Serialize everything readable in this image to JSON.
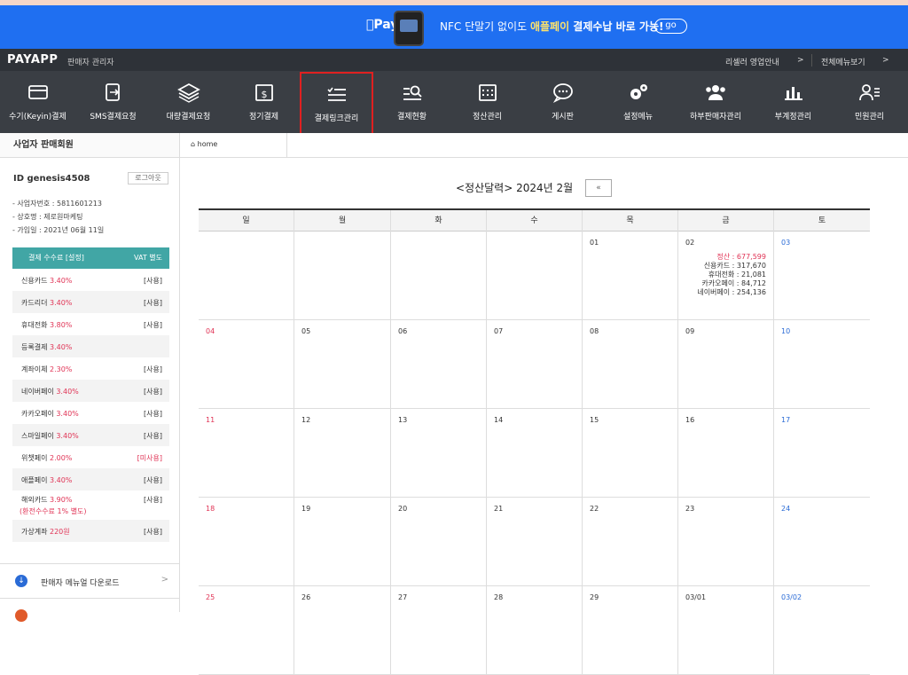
{
  "banner": {
    "pay_logo": "Pay",
    "message_prefix": "NFC 단말기 없이도 ",
    "message_highlight": "애플페이",
    "message_suffix": " 결제수납 바로 가능!",
    "go_label": "go"
  },
  "topbar": {
    "logo": "PAYAPP",
    "subtitle": "판매자 관리자",
    "links": [
      {
        "label": "리셀러 영업안내",
        "arrow": ">"
      },
      {
        "label": "전체메뉴보기",
        "arrow": ">"
      }
    ]
  },
  "nav": {
    "items": [
      {
        "label": "수기(Keyin)결제",
        "icon": "card-icon"
      },
      {
        "label": "SMS결제요청",
        "icon": "sms-icon"
      },
      {
        "label": "대량결제요청",
        "icon": "layers-icon"
      },
      {
        "label": "정기결제",
        "icon": "calendar-dollar-icon"
      },
      {
        "label": "결제링크관리",
        "icon": "list-check-icon"
      },
      {
        "label": "결제현황",
        "icon": "search-list-icon"
      },
      {
        "label": "정산관리",
        "icon": "calendar-grid-icon"
      },
      {
        "label": "게시판",
        "icon": "chat-bubble-icon"
      },
      {
        "label": "설정메뉴",
        "icon": "gears-icon"
      },
      {
        "label": "하부판매자관리",
        "icon": "users-icon"
      },
      {
        "label": "부계정관리",
        "icon": "bar-chart-icon"
      },
      {
        "label": "민원관리",
        "icon": "person-list-icon"
      }
    ]
  },
  "sidebar": {
    "title": "사업자 판매회원",
    "user_id": "ID  genesis4508",
    "logout_label": "로그아웃",
    "business_no": "- 사업자번호 : 5811601213",
    "company": "- 상호명 : 제로원마케팅",
    "joined": "- 가입일 : 2021년 06월 11일",
    "fee_header": "결제 수수료 [설정]",
    "vat_label": "VAT 별도",
    "fees": [
      {
        "name": "신용카드 ",
        "rate": "3.40%",
        "status": "[사용]"
      },
      {
        "name": "카드리더 ",
        "rate": "3.40%",
        "status": "[사용]"
      },
      {
        "name": "휴대전화 ",
        "rate": "3.80%",
        "status": "[사용]"
      },
      {
        "name": "등록결제 ",
        "rate": "3.40%",
        "status": ""
      },
      {
        "name": "계좌이체 ",
        "rate": "2.30%",
        "status": "[사용]"
      },
      {
        "name": "네이버페이 ",
        "rate": "3.40%",
        "status": "[사용]"
      },
      {
        "name": "카카오페이 ",
        "rate": "3.40%",
        "status": "[사용]"
      },
      {
        "name": "스마일페이 ",
        "rate": "3.40%",
        "status": "[사용]"
      },
      {
        "name": "위챗페이 ",
        "rate": "2.00%",
        "status": "[미사용]"
      },
      {
        "name": "애플페이 ",
        "rate": "3.40%",
        "status": "[사용]"
      },
      {
        "name": "해외카드 ",
        "rate": "3.90%",
        "status": "[사용]",
        "extra": "(환전수수료 1% 별도)"
      },
      {
        "name": "가상계좌 ",
        "rate": "220원",
        "status": "[사용]"
      }
    ],
    "manual_download": "판매자 메뉴얼 다운로드",
    "menu_arrow": ">"
  },
  "breadcrumb": {
    "home": "home"
  },
  "calendar": {
    "title": "<정산달력> 2024년 2월",
    "prev_label": "«",
    "weekdays": [
      "일",
      "월",
      "화",
      "수",
      "목",
      "금",
      "토"
    ],
    "weeks": [
      [
        "",
        "",
        "",
        "",
        "01",
        "02",
        "03"
      ],
      [
        "04",
        "05",
        "06",
        "07",
        "08",
        "09",
        "10"
      ],
      [
        "11",
        "12",
        "13",
        "14",
        "15",
        "16",
        "17"
      ],
      [
        "18",
        "19",
        "20",
        "21",
        "22",
        "23",
        "24"
      ],
      [
        "25",
        "26",
        "27",
        "28",
        "29",
        "03/01",
        "03/02"
      ]
    ],
    "details": {
      "0-5": {
        "settle": "정산 : 677,599",
        "lines": [
          "신용카드 : 317,670",
          "휴대전화 : 21,081",
          "카카오페이 : 84,712",
          "네이버페이 : 254,136"
        ]
      }
    }
  },
  "colors": {
    "banner_bg": "#1f6ff1",
    "nav_bg": "#3a3e44",
    "fee_header_bg": "#41a6a5",
    "accent_red": "#e03355",
    "saturday_blue": "#2a6bd6"
  }
}
